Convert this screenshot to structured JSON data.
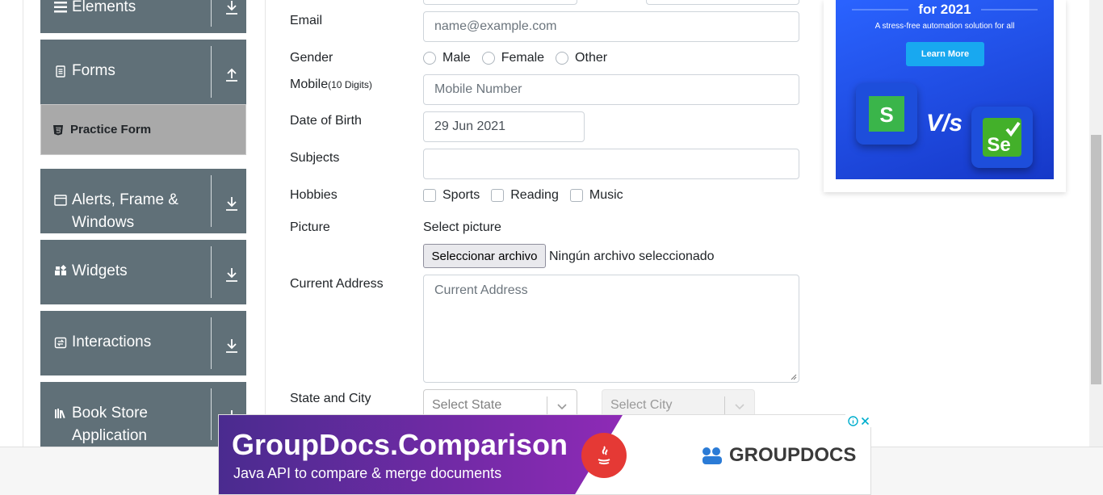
{
  "sidebar": {
    "groups": [
      {
        "label": "Elements",
        "icon": "menu-icon",
        "arrow": "download-arrow-icon"
      },
      {
        "label": "Forms",
        "icon": "document-icon",
        "arrow": "upload-arrow-icon"
      },
      {
        "label": "Alerts, Frame & Windows",
        "icon": "window-icon",
        "arrow": "download-arrow-icon"
      },
      {
        "label": "Widgets",
        "icon": "widgets-icon",
        "arrow": "download-arrow-icon"
      },
      {
        "label": "Interactions",
        "icon": "interaction-icon",
        "arrow": "download-arrow-icon"
      },
      {
        "label": "Book Store Application",
        "icon": "books-icon",
        "arrow": "download-arrow-icon"
      }
    ],
    "active_item": "Practice Form"
  },
  "form": {
    "email_label": "Email",
    "email_placeholder": "name@example.com",
    "gender_label": "Gender",
    "gender_options": [
      "Male",
      "Female",
      "Other"
    ],
    "mobile_label": "Mobile",
    "mobile_hint": "(10 Digits)",
    "mobile_placeholder": "Mobile Number",
    "dob_label": "Date of Birth",
    "dob_value": "29 Jun 2021",
    "subjects_label": "Subjects",
    "hobbies_label": "Hobbies",
    "hobbies_options": [
      "Sports",
      "Reading",
      "Music"
    ],
    "picture_label": "Picture",
    "picture_select_text": "Select picture",
    "file_button": "Seleccionar archivo",
    "file_status": "Ningún archivo seleccionado",
    "address_label": "Current Address",
    "address_placeholder": "Current Address",
    "state_city_label": "State and City",
    "state_placeholder": "Select State",
    "city_placeholder": "Select City"
  },
  "ad_right": {
    "headline": "for 2021",
    "subtext": "A stress-free automation solution for all",
    "button": "Learn More",
    "vs_text": "V/s",
    "logo_left": "S",
    "logo_right": "Se"
  },
  "ad_bottom": {
    "title": "GroupDocs.Comparison",
    "subtitle": "Java API to compare & merge documents",
    "brand": "GROUPDOCS"
  },
  "colors": {
    "sidebar_bg": "#607078",
    "active_item_bg": "#a9a9a9",
    "ad_blue": "#2a63ff",
    "learn_more": "#18a8f0",
    "banner_purple": "#7b2aa8"
  }
}
